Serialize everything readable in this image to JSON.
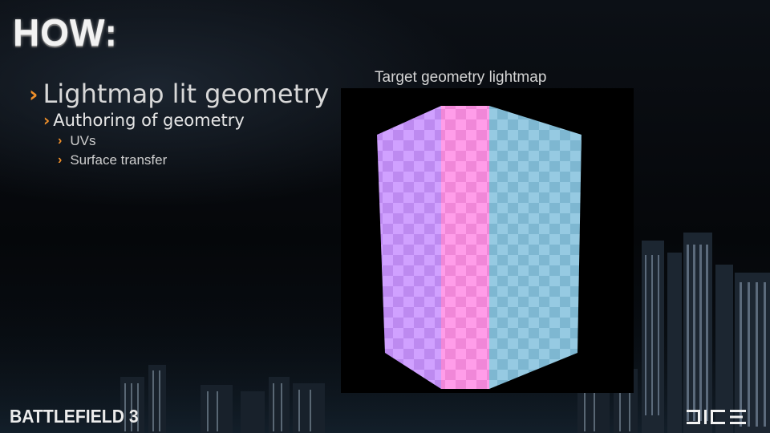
{
  "slide": {
    "title": "HOW:",
    "bullets": {
      "level1": "Lightmap lit geometry",
      "level2": "Authoring of geometry",
      "level3": [
        "UVs",
        "Surface transfer"
      ]
    },
    "chevron_glyph": "›",
    "figure": {
      "caption": "Target geometry lightmap",
      "face_colors": {
        "left": "#c993ff",
        "front": "#ff8fe6",
        "right": "#86c2de"
      }
    },
    "logos": {
      "game": "BATTLEFIELD 3",
      "studio": "DICE"
    },
    "accent_color": "#f0902a"
  }
}
